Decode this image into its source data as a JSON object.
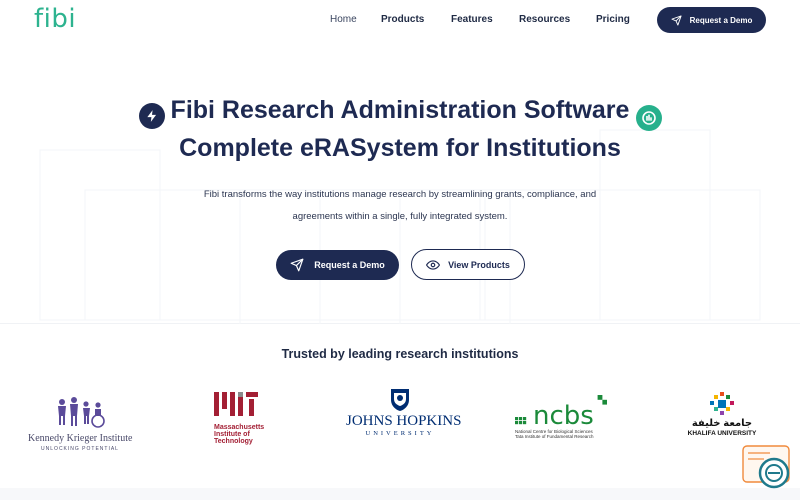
{
  "nav": {
    "logo": "fibi",
    "links": [
      "Home",
      "Products",
      "Features",
      "Resources",
      "Pricing"
    ],
    "cta_label": "Request a Demo"
  },
  "hero": {
    "title_line1": "Fibi Research Administration Software",
    "title_line2": "Complete eRASystem for Institutions",
    "subtitle": "Fibi transforms the way institutions manage research by streamlining grants, compliance, and agreements within a single, fully integrated system.",
    "primary_button": "Request a Demo",
    "secondary_button": "View Products",
    "icons": [
      "bolt-icon",
      "chart-icon",
      "send-icon",
      "eye-icon"
    ]
  },
  "trusted": {
    "title": "Trusted by leading research institutions",
    "logos": {
      "kki": {
        "name": "Kennedy Krieger Institute",
        "tagline": "UNLOCKING POTENTIAL"
      },
      "mit": {
        "mark": "MIT",
        "line1": "Massachusetts",
        "line2": "Institute of",
        "line3": "Technology"
      },
      "jhu": {
        "name": "JOHNS HOPKINS",
        "sub": "UNIVERSITY"
      },
      "ncbs": {
        "mark": "ncbs",
        "line1": "National Centre for Biological Sciences",
        "line2": "Tata Institute of Fundamental Research"
      },
      "ku": {
        "arabic": "جامعة خليفة",
        "name": "KHALIFA UNIVERSITY"
      }
    }
  },
  "colors": {
    "brand_green": "#2db38f",
    "navy": "#1e2a52",
    "mit_red": "#a31f34",
    "jhu_blue": "#002d72",
    "ncbs_green": "#1b8a3a",
    "kki_purple": "#5b4b9a"
  }
}
